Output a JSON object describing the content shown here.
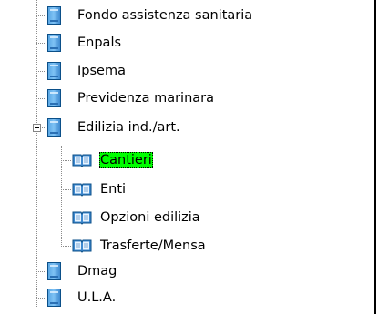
{
  "tree": {
    "items": [
      {
        "label": "Fondo assistenza sanitaria",
        "icon": "document-icon"
      },
      {
        "label": "Enpals",
        "icon": "document-icon"
      },
      {
        "label": "Ipsema",
        "icon": "document-icon"
      },
      {
        "label": "Previdenza marinara",
        "icon": "document-icon"
      },
      {
        "label": "Edilizia ind./art.",
        "icon": "document-icon",
        "expanded": true
      },
      {
        "label": "Cantieri",
        "icon": "book-icon",
        "selected": true
      },
      {
        "label": "Enti",
        "icon": "book-icon"
      },
      {
        "label": "Opzioni edilizia",
        "icon": "book-icon"
      },
      {
        "label": "Trasferte/Mensa",
        "icon": "book-icon"
      },
      {
        "label": "Dmag",
        "icon": "document-icon"
      },
      {
        "label": "U.L.A.",
        "icon": "document-icon"
      }
    ],
    "selected_highlight_color": "#00ff00",
    "icon_blue": "#4a9be0"
  }
}
